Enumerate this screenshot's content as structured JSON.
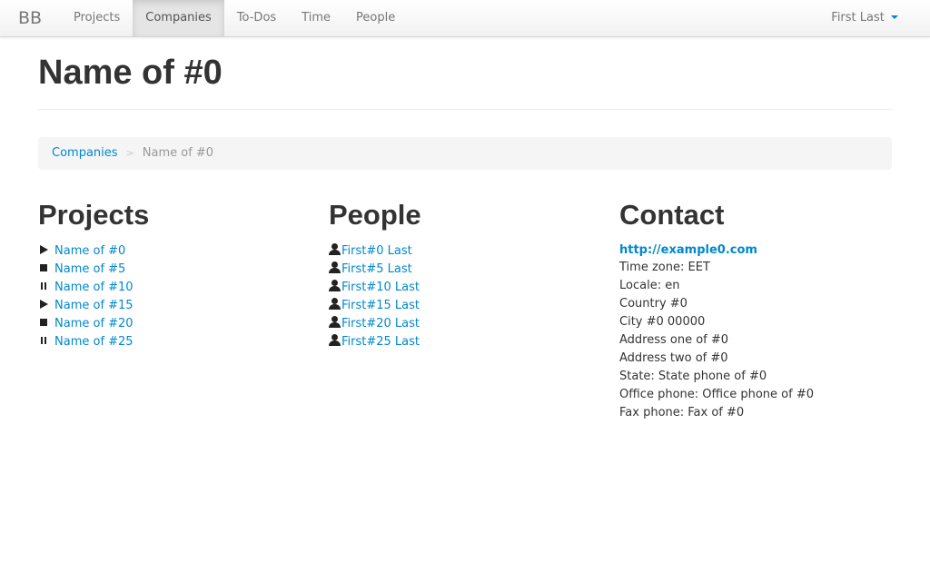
{
  "navbar": {
    "brand": "BB",
    "items": [
      {
        "label": "Projects",
        "active": false
      },
      {
        "label": "Companies",
        "active": true
      },
      {
        "label": "To-Dos",
        "active": false
      },
      {
        "label": "Time",
        "active": false
      },
      {
        "label": "People",
        "active": false
      }
    ],
    "user_name": "First Last"
  },
  "page": {
    "title": "Name of #0"
  },
  "breadcrumb": {
    "parent": "Companies",
    "separator": ">",
    "current": "Name of #0"
  },
  "projects": {
    "heading": "Projects",
    "items": [
      {
        "name": "Name of #0",
        "status_icon": "play-icon"
      },
      {
        "name": "Name of #5",
        "status_icon": "stop-icon"
      },
      {
        "name": "Name of #10",
        "status_icon": "pause-icon"
      },
      {
        "name": "Name of #15",
        "status_icon": "play-icon"
      },
      {
        "name": "Name of #20",
        "status_icon": "stop-icon"
      },
      {
        "name": "Name of #25",
        "status_icon": "pause-icon"
      }
    ]
  },
  "people": {
    "heading": "People",
    "items": [
      "First#0 Last",
      "First#5 Last",
      "First#10 Last",
      "First#15 Last",
      "First#20 Last",
      "First#25 Last"
    ]
  },
  "contact": {
    "heading": "Contact",
    "website": "http://example0.com",
    "lines": [
      "Time zone: EET",
      "Locale: en",
      "Country #0",
      "City #0 00000",
      "Address one of #0",
      "Address two of #0",
      "State: State phone of #0",
      "Office phone: Office phone of #0",
      "Fax phone: Fax of #0"
    ]
  },
  "colors": {
    "link": "#0088cc",
    "text": "#333333",
    "muted": "#999999",
    "breadcrumb_bg": "#f5f5f5"
  }
}
